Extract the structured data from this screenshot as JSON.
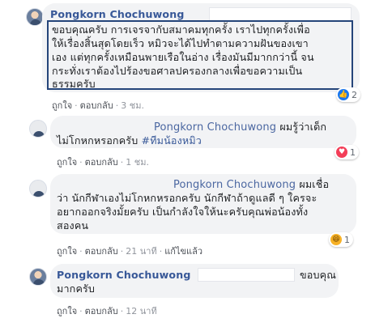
{
  "comments": [
    {
      "author": "Pongkorn Chochuwong",
      "lines": [
        "ขอบคุณครับ การเจรจากับสมาคมทุกครั้ง เราไปทุกครั้งเพื่อ",
        "ให้เรื่องสิ้นสุดโดยเร็ว หมิวจะได้ไปทำตามความฝันของเขา",
        "เอง แต่ทุกครั้งเหมือนพายเรือในอ่าง เรื่องมันมีมากกว่านี้ จน",
        "กระทั่งเราต้องไปร้องขอศาลปครองกลางเพื่อขอความเป็น",
        "ธรรมครับ"
      ],
      "like": "ถูกใจ",
      "reply": "ตอบกลับ",
      "time": "3 ชม.",
      "reaction_count": "2",
      "reaction_icons": [
        "like-icon",
        "heart-icon"
      ]
    },
    {
      "author": "Pongkorn Chochuwong",
      "text_after_name": "ผมรู้ว่าเด็ก",
      "line2_plain": "ไม่โกหกหรอกครับ ",
      "hashtag": "#ทีมน้องหมิว",
      "like": "ถูกใจ",
      "reply": "ตอบกลับ",
      "time": "1 ชม.",
      "reaction_count": "1",
      "reaction_icons": [
        "heart-icon"
      ]
    },
    {
      "author": "Pongkorn Chochuwong",
      "text_after_name": "ผมเชื่อ",
      "lines": [
        "ว่า นักกีฬาเองไม่โกหกหรอกครับ นักกีฬาถ้าดูแลดี ๆ ใครจะ",
        "อยากออกจริงมั้ยครับ เป็นกำลังใจให้นะครับคุณพ่อน้องทั้ง",
        "สองคน"
      ],
      "like": "ถูกใจ",
      "reply": "ตอบกลับ",
      "time": "21 นาที",
      "edited": "แก้ไขแล้ว",
      "reaction_count": "1",
      "reaction_icons": [
        "haha-icon"
      ]
    },
    {
      "author": "Pongkorn Chochuwong",
      "text_after_name": "ขอบคุณ",
      "line2": "มากครับ",
      "like": "ถูกใจ",
      "reply": "ตอบกลับ",
      "time": "12 นาที"
    }
  ],
  "colors": {
    "name": "#385898",
    "bubble": "#f2f3f5",
    "meta": "#90949c",
    "highlight": "#25457a"
  }
}
